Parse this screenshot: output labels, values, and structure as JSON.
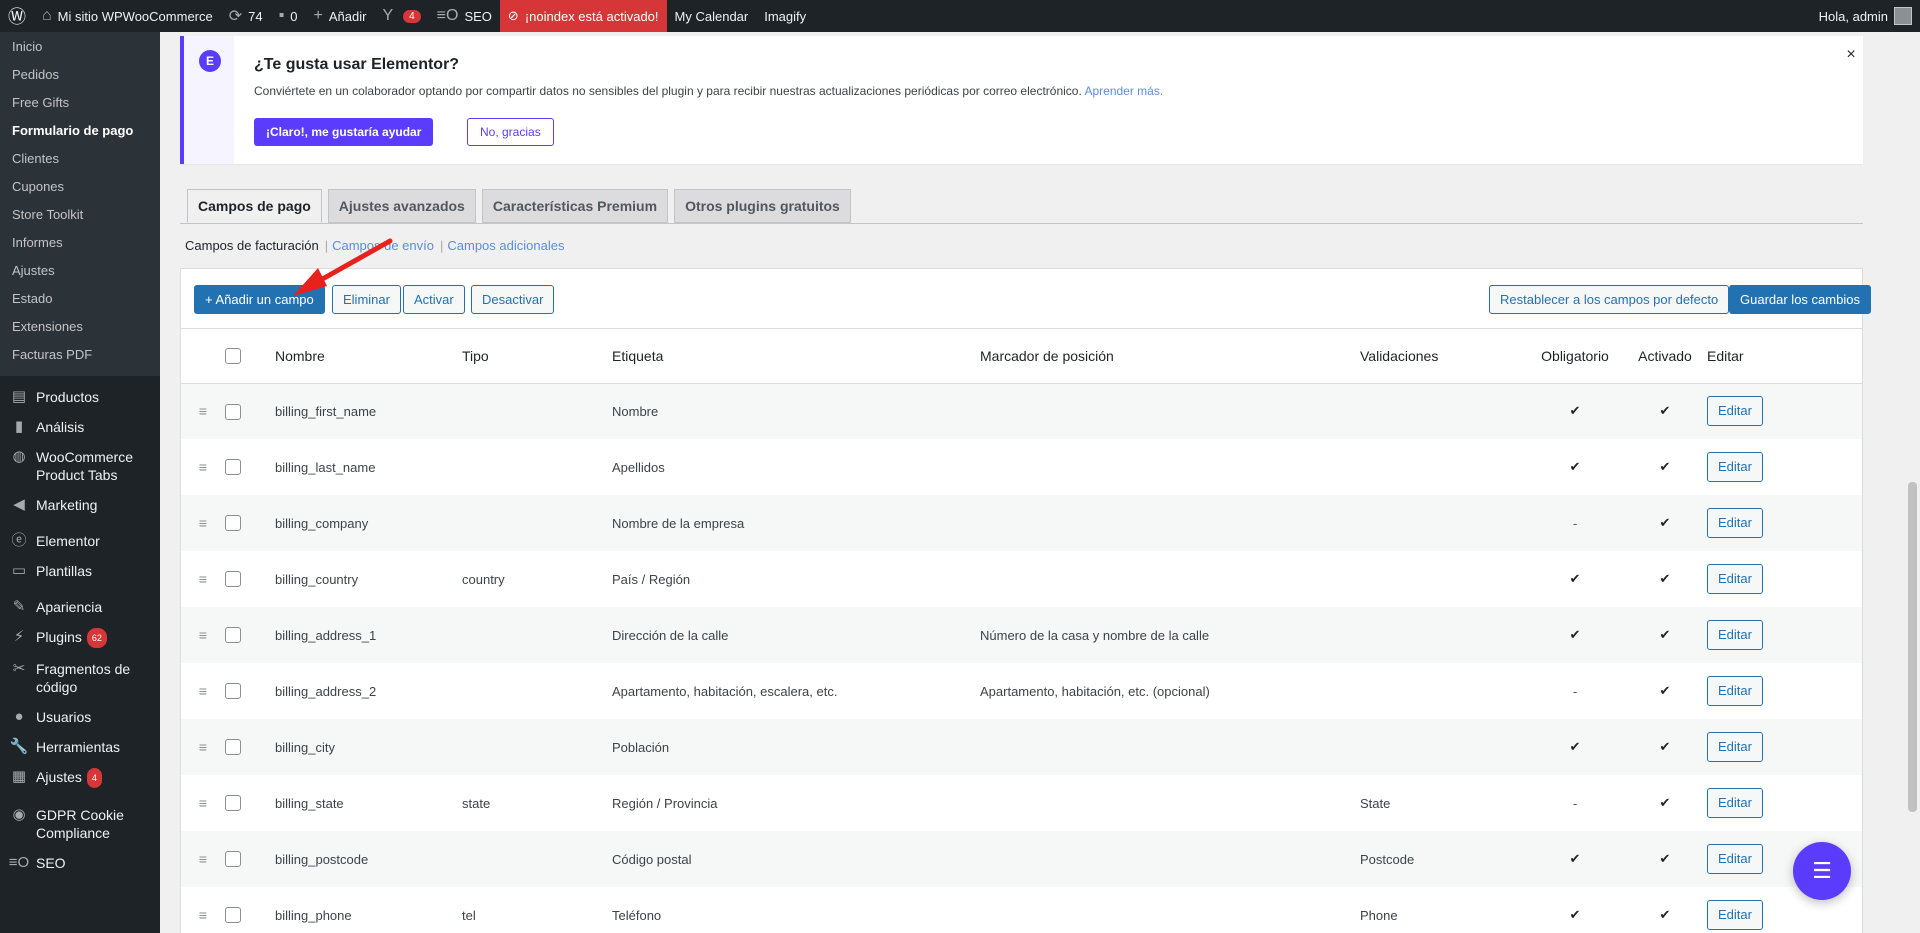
{
  "adminbar": {
    "site_name": "Mi sitio WPWooCommerce",
    "updates_count": "74",
    "comments_count": "0",
    "add_label": "Añadir",
    "yoast_count": "4",
    "seo_label": "SEO",
    "noindex_label": "¡noindex está activado!",
    "calendar_label": "My Calendar",
    "imagify_label": "Imagify",
    "greeting": "Hola, admin"
  },
  "submenu": [
    "Inicio",
    "Pedidos",
    "Free Gifts",
    "Formulario de pago",
    "Clientes",
    "Cupones",
    "Store Toolkit",
    "Informes",
    "Ajustes",
    "Estado",
    "Extensiones",
    "Facturas PDF"
  ],
  "menu": [
    {
      "label": "Productos",
      "icon": "products-icon"
    },
    {
      "label": "Análisis",
      "icon": "analytics-icon"
    },
    {
      "label": "WooCommerce Product Tabs",
      "icon": "globe-icon"
    },
    {
      "label": "Marketing",
      "icon": "megaphone-icon"
    },
    {
      "label": "Elementor",
      "icon": "elementor-icon"
    },
    {
      "label": "Plantillas",
      "icon": "folder-icon"
    },
    {
      "label": "Apariencia",
      "icon": "brush-icon"
    },
    {
      "label": "Plugins",
      "icon": "plugin-icon",
      "count": "62"
    },
    {
      "label": "Fragmentos de código",
      "icon": "scissors-icon"
    },
    {
      "label": "Usuarios",
      "icon": "user-icon"
    },
    {
      "label": "Herramientas",
      "icon": "wrench-icon"
    },
    {
      "label": "Ajustes",
      "icon": "settings-icon",
      "count": "4"
    },
    {
      "label": "GDPR Cookie Compliance",
      "icon": "shield-icon"
    },
    {
      "label": "SEO",
      "icon": "seo-icon"
    }
  ],
  "notice": {
    "title": "¿Te gusta usar Elementor?",
    "text": "Conviértete en un colaborador optando por compartir datos no sensibles del plugin y para recibir nuestras actualizaciones periódicas por correo electrónico.",
    "link": "Aprender más.",
    "yes_label": "¡Claro!, me gustaría ayudar",
    "no_label": "No, gracias",
    "close": "×"
  },
  "tabs": [
    "Campos de pago",
    "Ajustes avanzados",
    "Características Premium",
    "Otros plugins gratuitos"
  ],
  "subnav": {
    "current": "Campos de facturación",
    "shipping": "Campos de envío",
    "additional": "Campos adicionales"
  },
  "toolbar": {
    "add": "+ Añadir un campo",
    "delete": "Eliminar",
    "enable": "Activar",
    "disable": "Desactivar",
    "reset": "Restablecer a los campos por defecto",
    "save": "Guardar los cambios"
  },
  "table": {
    "headers": [
      "Nombre",
      "Tipo",
      "Etiqueta",
      "Marcador de posición",
      "Validaciones",
      "Obligatorio",
      "Activado",
      "Editar"
    ],
    "edit_label": "Editar",
    "rows": [
      {
        "name": "billing_first_name",
        "type": "",
        "label": "Nombre",
        "placeholder": "",
        "validation": "",
        "required": "✔",
        "enabled": "✔"
      },
      {
        "name": "billing_last_name",
        "type": "",
        "label": "Apellidos",
        "placeholder": "",
        "validation": "",
        "required": "✔",
        "enabled": "✔"
      },
      {
        "name": "billing_company",
        "type": "",
        "label": "Nombre de la empresa",
        "placeholder": "",
        "validation": "",
        "required": "-",
        "enabled": "✔"
      },
      {
        "name": "billing_country",
        "type": "country",
        "label": "País / Región",
        "placeholder": "",
        "validation": "",
        "required": "✔",
        "enabled": "✔"
      },
      {
        "name": "billing_address_1",
        "type": "",
        "label": "Dirección de la calle",
        "placeholder": "Número de la casa y nombre de la calle",
        "validation": "",
        "required": "✔",
        "enabled": "✔"
      },
      {
        "name": "billing_address_2",
        "type": "",
        "label": "Apartamento, habitación, escalera, etc.",
        "placeholder": "Apartamento, habitación, etc. (opcional)",
        "validation": "",
        "required": "-",
        "enabled": "✔"
      },
      {
        "name": "billing_city",
        "type": "",
        "label": "Población",
        "placeholder": "",
        "validation": "",
        "required": "✔",
        "enabled": "✔"
      },
      {
        "name": "billing_state",
        "type": "state",
        "label": "Región / Provincia",
        "placeholder": "",
        "validation": "State",
        "required": "-",
        "enabled": "✔"
      },
      {
        "name": "billing_postcode",
        "type": "",
        "label": "Código postal",
        "placeholder": "",
        "validation": "Postcode",
        "required": "✔",
        "enabled": "✔"
      },
      {
        "name": "billing_phone",
        "type": "tel",
        "label": "Teléfono",
        "placeholder": "",
        "validation": "Phone",
        "required": "✔",
        "enabled": "✔"
      }
    ]
  },
  "colors": {
    "accent": "#2271b1",
    "elementor": "#5c3cfc",
    "noindex": "#d63638",
    "arrow": "#e8211c"
  }
}
